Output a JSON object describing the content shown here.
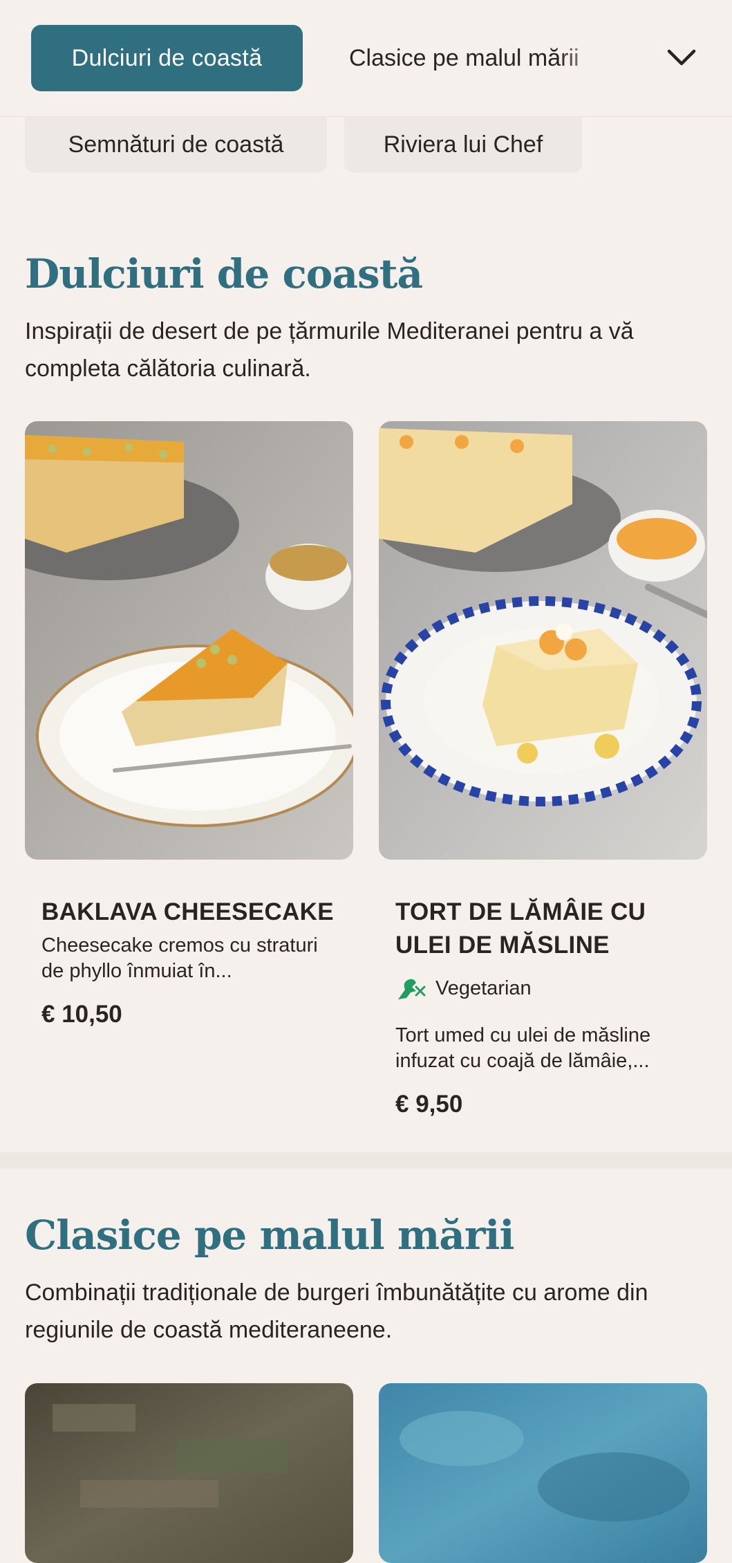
{
  "nav": {
    "active_tab": "Dulciuri de coastă",
    "second_tab": "Clasice pe malul mării",
    "dropdown_icon": "chevron-down-icon",
    "more_tabs": [
      "Semnături de coastă",
      "Riviera lui Chef"
    ]
  },
  "sections": [
    {
      "title": "Dulciuri de coastă",
      "description": "Inspirații de desert de pe țărmurile Mediteranei pentru a vă completa călătoria culinară.",
      "items": [
        {
          "name": "BAKLAVA CHEESECAKE",
          "description": "Cheesecake cremos cu straturi de phyllo înmuiat în...",
          "price": "€ 10,50"
        },
        {
          "name": "TORT DE LĂMÂIE CU ULEI DE MĂSLINE",
          "badge": "Vegetarian",
          "badge_icon": "dinosaur-leaf-icon",
          "description": "Tort umed cu ulei de măsline infuzat cu coajă de lămâie,...",
          "price": "€ 9,50"
        }
      ]
    },
    {
      "title": "Clasice pe malul mării",
      "description": "Combinații tradiționale de burgeri îmbunătățite cu arome din regiunile de coastă mediteraneene."
    }
  ],
  "colors": {
    "accent": "#2f6f80",
    "background": "#f6f0ec",
    "badge_green": "#1f9d63"
  }
}
